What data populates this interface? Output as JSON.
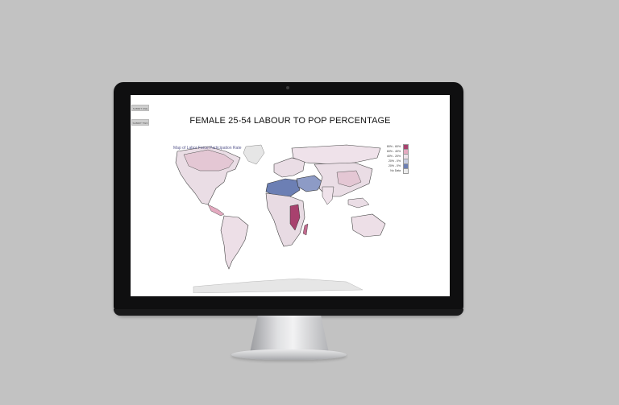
{
  "app": {
    "buttons": [
      "SUBMIT ONE",
      "SUBMIT TWO"
    ],
    "title": "FEMALE 25-54 LABOUR TO POP PERCENTAGE",
    "map_title": "Map of Labor Force Participation Rate"
  },
  "legend": {
    "items": [
      {
        "label": "80% - 60%",
        "color": "#a8416e"
      },
      {
        "label": "60% - 40%",
        "color": "#e4aac0"
      },
      {
        "label": "40% - 20%",
        "color": "#efe2ea"
      },
      {
        "label": "20% - 0%",
        "color": "#c8cee2"
      },
      {
        "label": "20% - 0%",
        "color": "#6c7fb4"
      },
      {
        "label": "No Data",
        "color": "#ececec"
      }
    ]
  },
  "colors": {
    "background": "#c2c2c2",
    "bezel": "#0f0f10",
    "high": "#a8416e",
    "mid_high": "#e4aac0",
    "mid": "#efe2ea",
    "low": "#6c7fb4",
    "nodata": "#e6e6e6"
  }
}
